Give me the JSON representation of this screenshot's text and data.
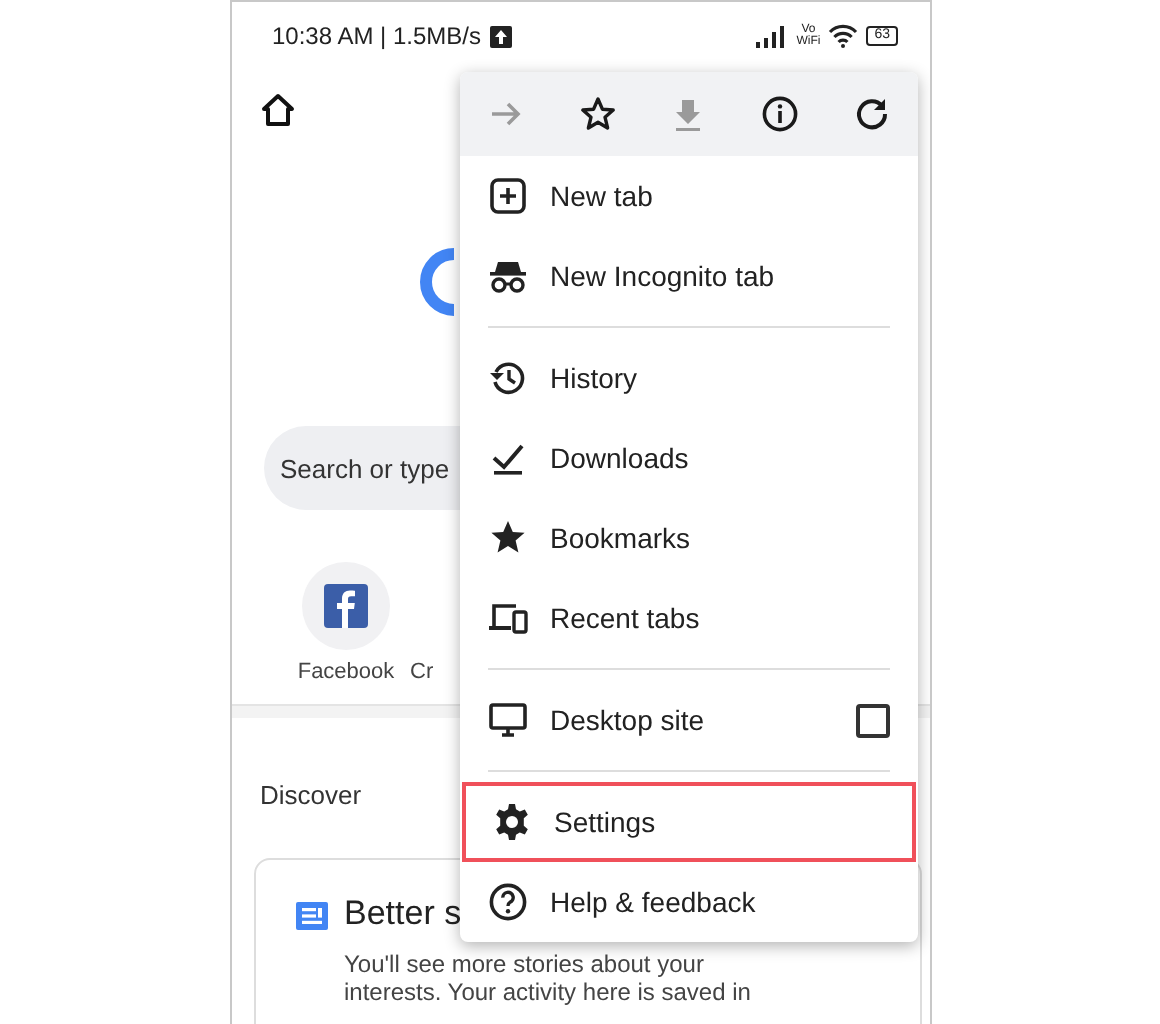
{
  "status_bar": {
    "time_speed": "10:38 AM | 1.5MB/s",
    "network_label": [
      "Vo",
      "WiFi"
    ],
    "battery": "63"
  },
  "new_tab_page": {
    "search": {
      "placeholder": "Search or type"
    },
    "shortcuts": [
      {
        "label": "Facebook",
        "kind": "facebook"
      },
      {
        "label": "Cr",
        "kind": "hidden"
      }
    ],
    "discover": {
      "heading": "Discover",
      "card": {
        "title": "Better s",
        "lines": [
          "You'll see more stories about your",
          "interests. Your activity here is saved in"
        ]
      }
    }
  },
  "menu": {
    "toolbar": [
      {
        "kind": "forward",
        "disabled": true
      },
      {
        "kind": "star",
        "disabled": false
      },
      {
        "kind": "download",
        "disabled": true
      },
      {
        "kind": "info",
        "disabled": false
      },
      {
        "kind": "refresh",
        "disabled": false
      }
    ],
    "groups": [
      [
        {
          "label": "New tab",
          "kind": "plus",
          "highlighted": false
        },
        {
          "label": "New Incognito tab",
          "kind": "incognito",
          "highlighted": false
        }
      ],
      [
        {
          "label": "History",
          "kind": "history",
          "highlighted": false
        },
        {
          "label": "Downloads",
          "kind": "downloads",
          "highlighted": false
        },
        {
          "label": "Bookmarks",
          "kind": "bookmark",
          "highlighted": false
        },
        {
          "label": "Recent tabs",
          "kind": "devices",
          "highlighted": false
        }
      ],
      [
        {
          "label": "Desktop site",
          "kind": "monitor",
          "highlighted": false,
          "checked": false
        }
      ],
      [
        {
          "label": "Settings",
          "kind": "gear",
          "highlighted": true
        },
        {
          "label": "Help & feedback",
          "kind": "help",
          "highlighted": false
        }
      ]
    ]
  }
}
